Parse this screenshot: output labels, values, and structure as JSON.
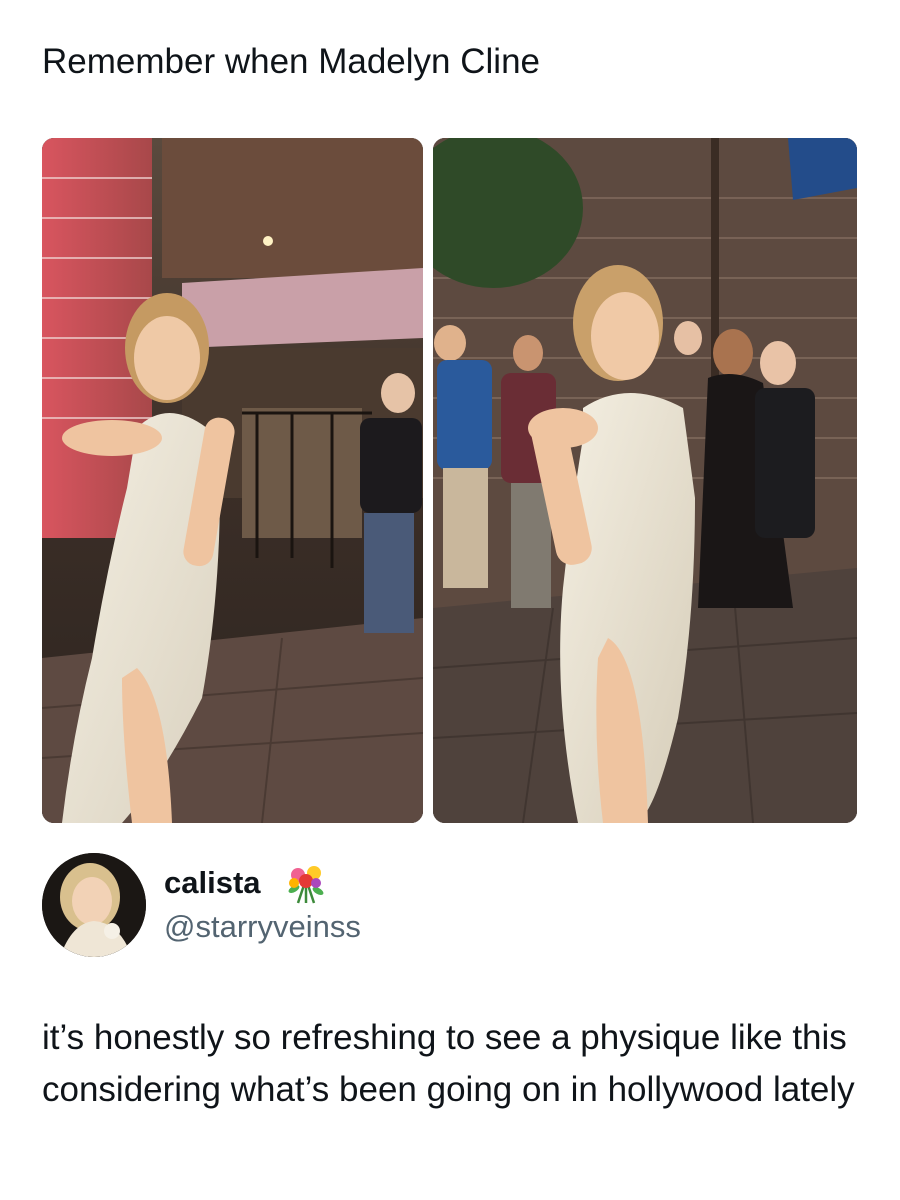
{
  "post": {
    "text": "Remember when Madelyn Cline"
  },
  "media": [
    {
      "label": "photo-left"
    },
    {
      "label": "photo-right"
    }
  ],
  "quoted": {
    "display_name": "calista",
    "name_emoji": "bouquet-icon",
    "handle": "@starryveinss",
    "text": "it’s honestly so refreshing to see a physique like this considering what’s been going on in hollywood lately"
  }
}
